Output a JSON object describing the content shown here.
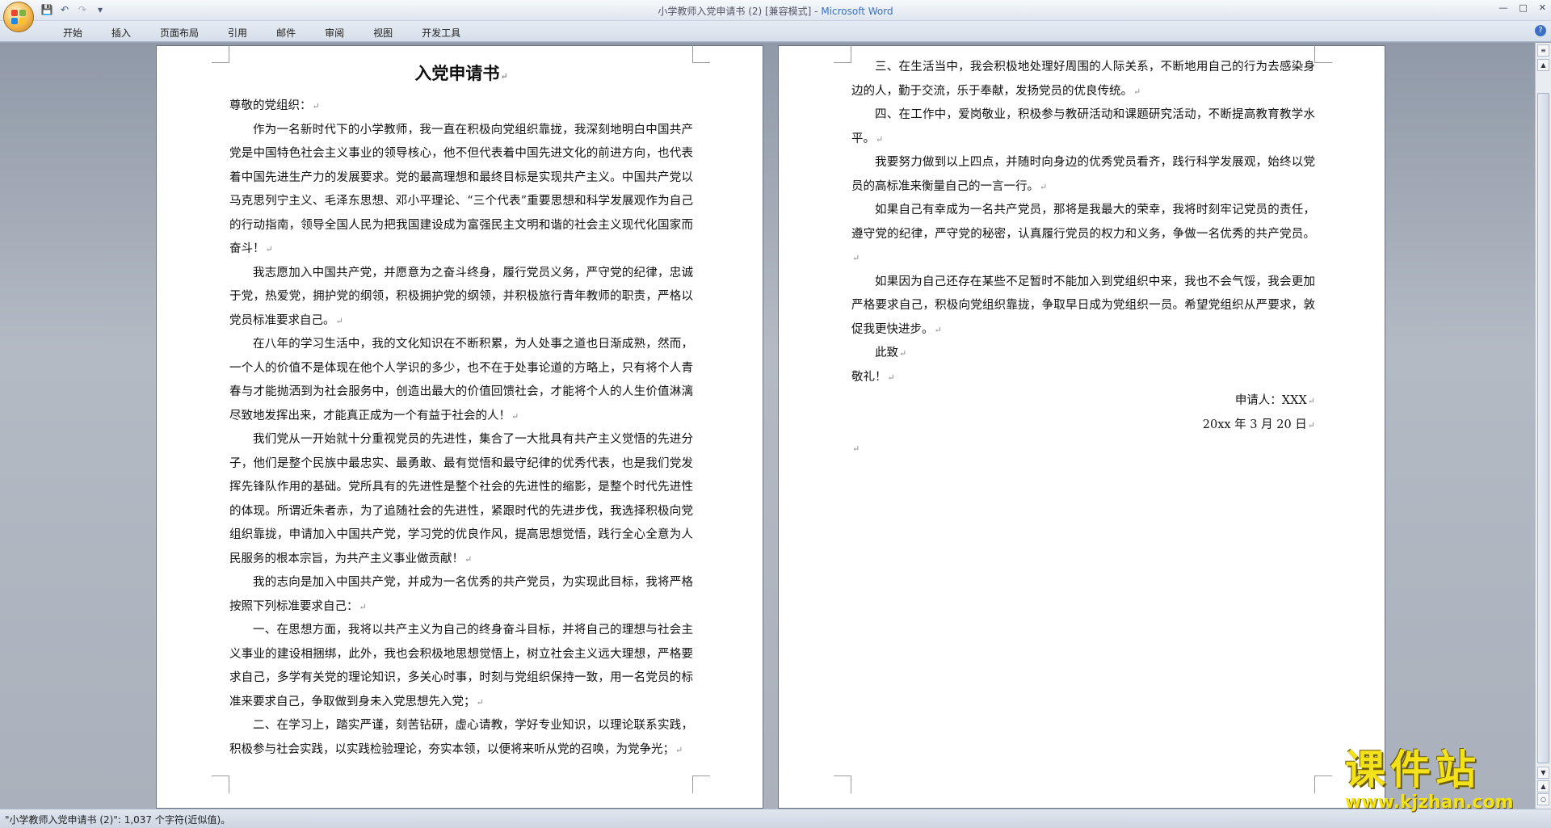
{
  "titlebar": {
    "doc_title": "小学教师入党申请书 (2) [兼容模式] - ",
    "app_name": "Microsoft Word",
    "qat": [
      "save-icon",
      "undo-icon",
      "redo-icon",
      "customize-icon"
    ]
  },
  "ribbon": {
    "tabs": [
      "开始",
      "插入",
      "页面布局",
      "引用",
      "邮件",
      "审阅",
      "视图",
      "开发工具"
    ]
  },
  "document": {
    "title": "入党申请书",
    "salutation": "尊敬的党组织：",
    "left_paragraphs": [
      "作为一名新时代下的小学教师，我一直在积极向党组织靠拢，我深刻地明白中国共产党是中国特色社会主义事业的领导核心，他不但代表着中国先进文化的前进方向，也代表着中国先进生产力的发展要求。党的最高理想和最终目标是实现共产主义。中国共产党以马克思列宁主义、毛泽东思想、邓小平理论、“三个代表”重要思想和科学发展观作为自己的行动指南，领导全国人民为把我国建设成为富强民主文明和谐的社会主义现代化国家而奋斗！",
      "我志愿加入中国共产党，并愿意为之奋斗终身，履行党员义务，严守党的纪律，忠诚于党，热爱党，拥护党的纲领，积极拥护党的纲领，并积极旅行青年教师的职责，严格以党员标准要求自己。",
      "在八年的学习生活中，我的文化知识在不断积累，为人处事之道也日渐成熟，然而，一个人的价值不是体现在他个人学识的多少，也不在于处事论道的方略上，只有将个人青春与才能抛洒到为社会服务中，创造出最大的价值回馈社会，才能将个人的人生价值淋漓尽致地发挥出来，才能真正成为一个有益于社会的人！",
      "我们党从一开始就十分重视党员的先进性，集合了一大批具有共产主义觉悟的先进分子，他们是整个民族中最忠实、最勇敢、最有觉悟和最守纪律的优秀代表，也是我们党发挥先锋队作用的基础。党所具有的先进性是整个社会的先进性的缩影，是整个时代先进性的体现。所谓近朱者赤，为了追随社会的先进性，紧跟时代的先进步伐，我选择积极向党组织靠拢，申请加入中国共产党，学习党的优良作风，提高思想觉悟，践行全心全意为人民服务的根本宗旨，为共产主义事业做贡献！",
      "我的志向是加入中国共产党，并成为一名优秀的共产党员，为实现此目标，我将严格按照下列标准要求自己：",
      "一、在思想方面，我将以共产主义为自己的终身奋斗目标，并将自己的理想与社会主义事业的建设相捆绑，此外，我也会积极地思想觉悟上，树立社会主义远大理想，严格要求自己，多学有关党的理论知识，多关心时事，时刻与党组织保持一致，用一名党员的标准来要求自己，争取做到身未入党思想先入党；",
      "二、在学习上，踏实严谨，刻苦钻研，虚心请教，学好专业知识，以理论联系实践，积极参与社会实践，以实践检验理论，夯实本领，以便将来听从党的召唤，为党争光；"
    ],
    "right_paragraphs": [
      "三、在生活当中，我会积极地处理好周围的人际关系，不断地用自己的行为去感染身边的人，勤于交流，乐于奉献，发扬党员的优良传统。",
      "四、在工作中，爱岗敬业，积极参与教研活动和课题研究活动，不断提高教育教学水平。",
      "我要努力做到以上四点，并随时向身边的优秀党员看齐，践行科学发展观，始终以党员的高标准来衡量自己的一言一行。",
      "如果自己有幸成为一名共产党员，那将是我最大的荣幸，我将时刻牢记党员的责任，遵守党的纪律，严守党的秘密，认真履行党员的权力和义务，争做一名优秀的共产党员。",
      "如果因为自己还存在某些不足暂时不能加入到党组织中来，我也不会气馁，我会更加严格要求自己，积极向党组织靠拢，争取早日成为党组织一员。希望党组织从严要求，敦促我更快进步。",
      "此致"
    ],
    "closing": "敬礼！",
    "signature": "申请人：XXX",
    "date": "20xx 年 3 月 20 日",
    "para_mark": "↵"
  },
  "statusbar": {
    "text": "\"小学教师入党申请书 (2)\": 1,037 个字符(近似值)。"
  },
  "watermark": {
    "title": "课件站",
    "url": "www.kjzhan.com"
  },
  "colors": {
    "accent": "#3a6fc4",
    "watermark": "#f3e21a"
  }
}
